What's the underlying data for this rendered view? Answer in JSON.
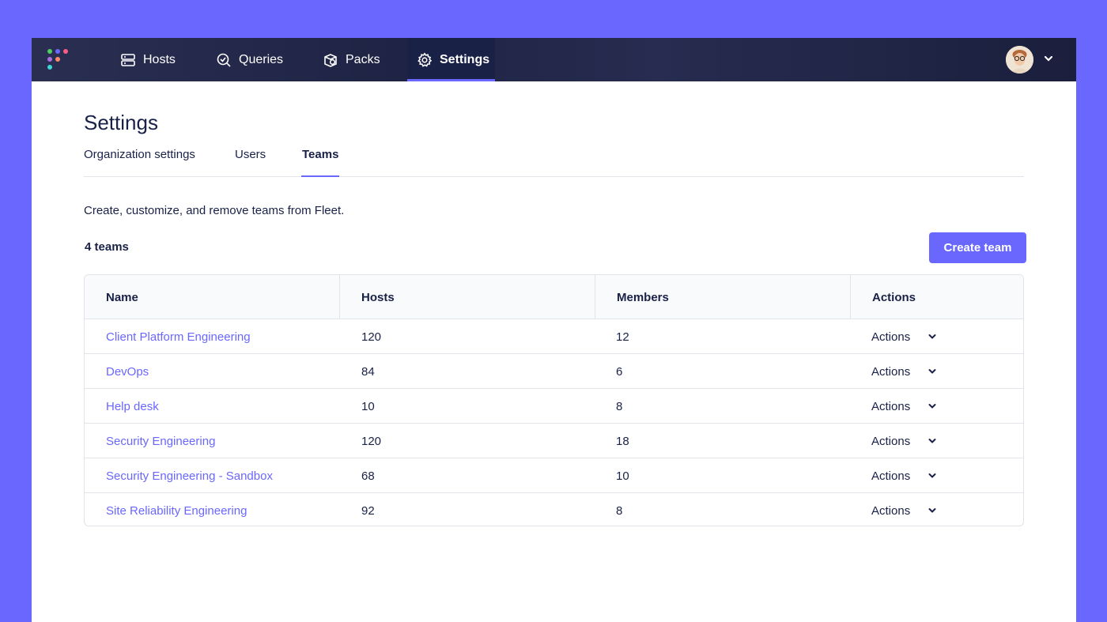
{
  "colors": {
    "accent": "#6a67fe",
    "nav_bg": "#192147",
    "text": "#192147"
  },
  "nav": {
    "items": [
      {
        "label": "Hosts",
        "icon": "hosts-icon"
      },
      {
        "label": "Queries",
        "icon": "queries-icon"
      },
      {
        "label": "Packs",
        "icon": "packs-icon"
      },
      {
        "label": "Settings",
        "icon": "gear-icon",
        "active": true
      }
    ]
  },
  "page": {
    "title": "Settings",
    "tabs": [
      {
        "label": "Organization settings"
      },
      {
        "label": "Users"
      },
      {
        "label": "Teams",
        "active": true
      }
    ],
    "description": "Create, customize, and remove teams from Fleet.",
    "count": "4 teams",
    "create_button": "Create team"
  },
  "table": {
    "columns": [
      "Name",
      "Hosts",
      "Members",
      "Actions"
    ],
    "rows": [
      {
        "name": "Client Platform Engineering",
        "hosts": "120",
        "members": "12",
        "actions": "Actions"
      },
      {
        "name": "DevOps",
        "hosts": "84",
        "members": "6",
        "actions": "Actions"
      },
      {
        "name": "Help desk",
        "hosts": "10",
        "members": "8",
        "actions": "Actions"
      },
      {
        "name": "Security Engineering",
        "hosts": "120",
        "members": "18",
        "actions": "Actions"
      },
      {
        "name": "Security Engineering - Sandbox",
        "hosts": "68",
        "members": "10",
        "actions": "Actions"
      },
      {
        "name": "Site Reliability Engineering",
        "hosts": "92",
        "members": "8",
        "actions": "Actions"
      }
    ]
  }
}
